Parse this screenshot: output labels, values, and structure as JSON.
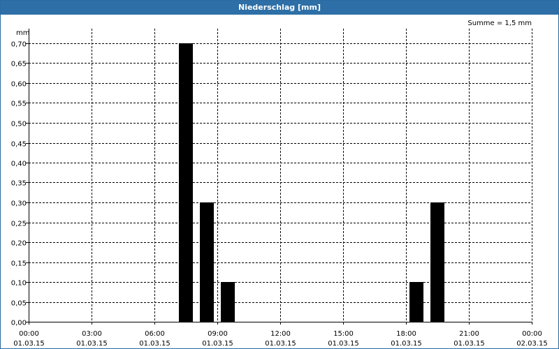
{
  "window": {
    "title": "Niederschlag [mm]"
  },
  "chart_data": {
    "type": "bar",
    "title": "Niederschlag [mm]",
    "annotation": "Summe = 1,5 mm",
    "ylabel": "mm",
    "xlabel": "",
    "ylim": [
      0,
      0.7
    ],
    "y_ticks": [
      "0,00",
      "0,05",
      "0,10",
      "0,15",
      "0,20",
      "0,25",
      "0,30",
      "0,35",
      "0,40",
      "0,45",
      "0,50",
      "0,55",
      "0,60",
      "0,65",
      "0,70"
    ],
    "x_ticks": [
      {
        "time": "00:00",
        "date": "01.03.15"
      },
      {
        "time": "03:00",
        "date": "01.03.15"
      },
      {
        "time": "06:00",
        "date": "01.03.15"
      },
      {
        "time": "09:00",
        "date": "01.03.15"
      },
      {
        "time": "12:00",
        "date": "01.03.15"
      },
      {
        "time": "15:00",
        "date": "01.03.15"
      },
      {
        "time": "18:00",
        "date": "01.03.15"
      },
      {
        "time": "21:00",
        "date": "01.03.15"
      },
      {
        "time": "00:00",
        "date": "02.03.15"
      }
    ],
    "bars": [
      {
        "time": "07:00",
        "value": 0.7
      },
      {
        "time": "08:00",
        "value": 0.3
      },
      {
        "time": "09:00",
        "value": 0.1
      },
      {
        "time": "18:00",
        "value": 0.1
      },
      {
        "time": "19:00",
        "value": 0.3
      }
    ],
    "grid": true,
    "bar_color": "#000000"
  }
}
